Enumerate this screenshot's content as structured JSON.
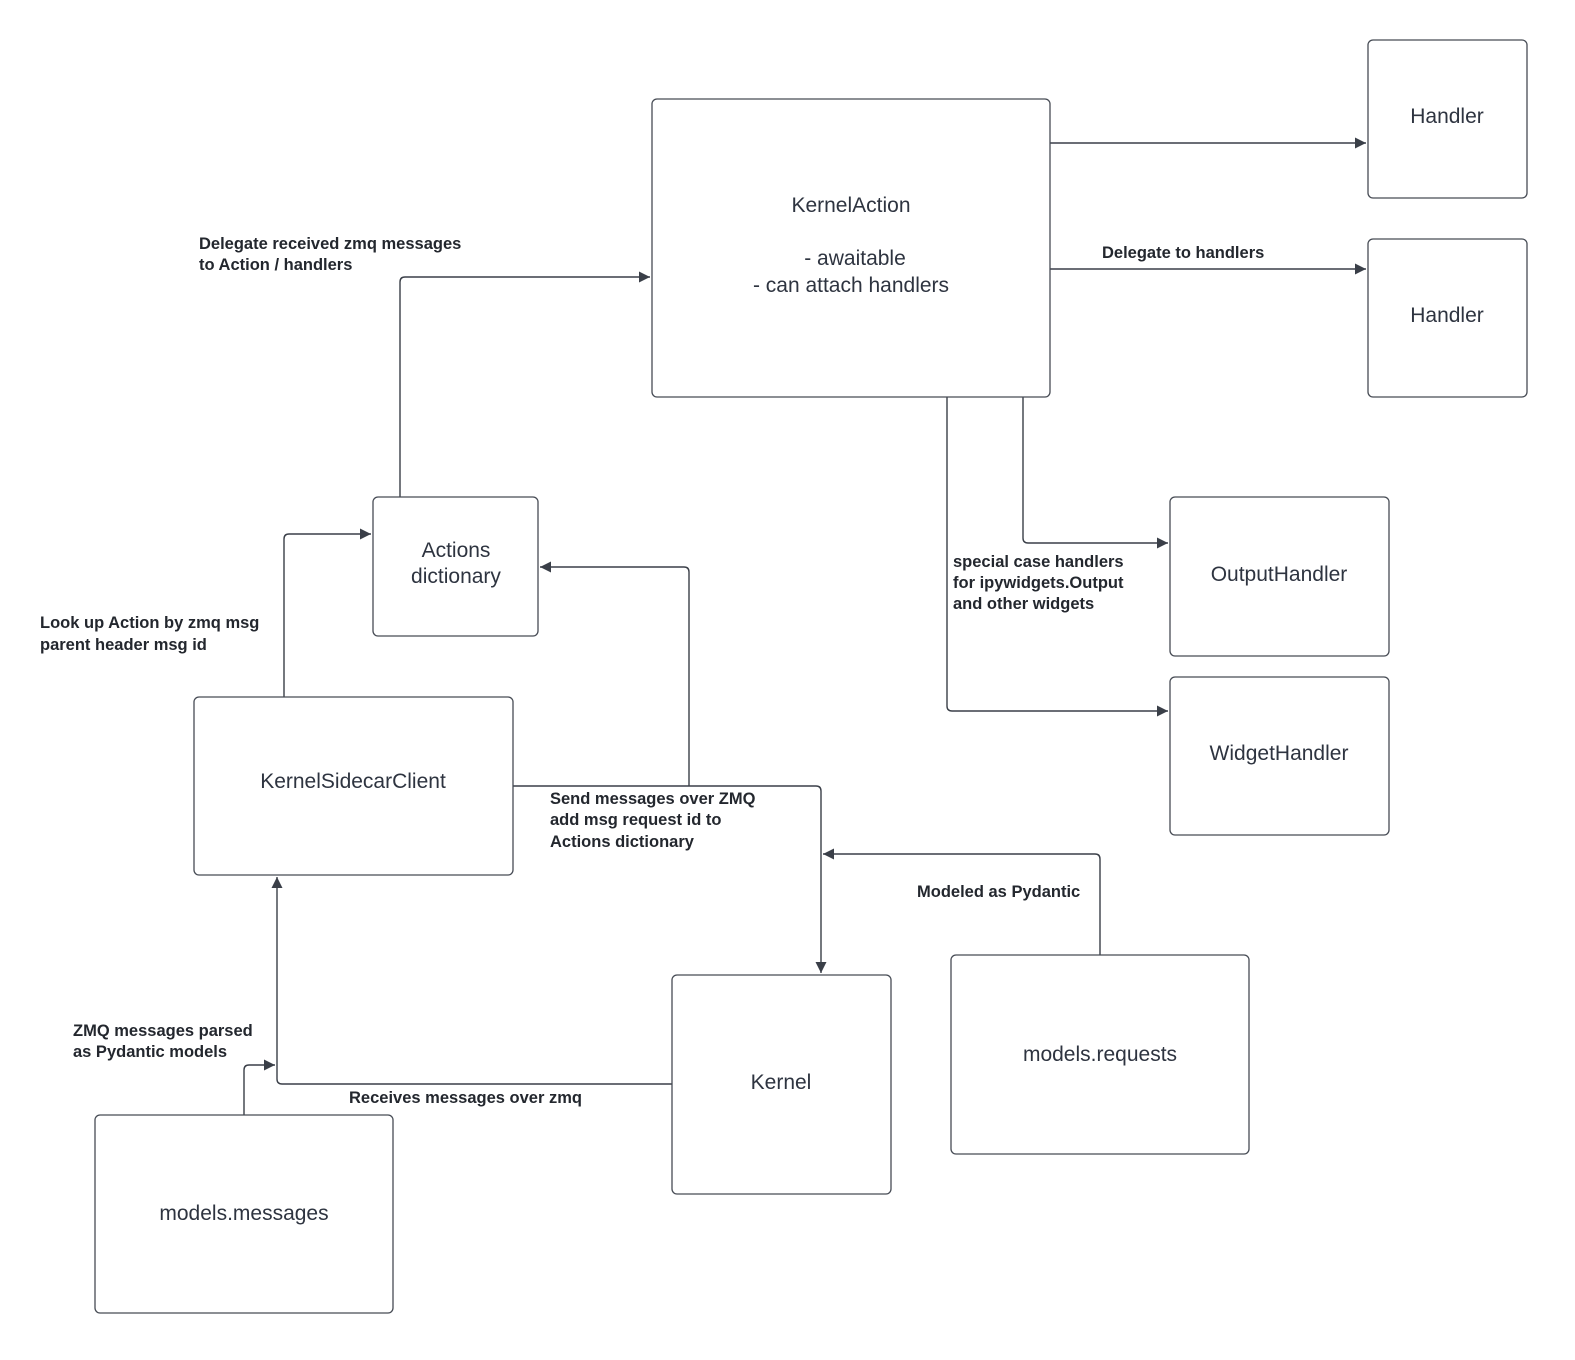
{
  "colors": {
    "stroke": "#474c55",
    "text": "#2e3440",
    "label": "#23272e"
  },
  "nodes": {
    "kernel_action": {
      "title": "KernelAction",
      "lines": [
        "- awaitable",
        "- can attach handlers"
      ]
    },
    "handler_1": "Handler",
    "handler_2": "Handler",
    "actions_dictionary": [
      "Actions",
      "dictionary"
    ],
    "output_handler": "OutputHandler",
    "widget_handler": "WidgetHandler",
    "kernel_sidecar_client": "KernelSidecarClient",
    "kernel": "Kernel",
    "models_requests": "models.requests",
    "models_messages": "models.messages"
  },
  "edge_labels": {
    "delegate_received": [
      "Delegate received zmq messages",
      "to Action / handlers"
    ],
    "delegate_to_handlers": "Delegate to handlers",
    "look_up_action": [
      "Look up Action by zmq msg",
      "parent header msg id"
    ],
    "special_case": [
      "special case handlers",
      "for ipywidgets.Output",
      "and other widgets"
    ],
    "send_messages": [
      "Send messages over ZMQ",
      "add msg request id to",
      "Actions dictionary"
    ],
    "modeled_as_pydantic": "Modeled as Pydantic",
    "zmq_parsed": [
      "ZMQ messages parsed",
      "as Pydantic models"
    ],
    "receives_messages": "Receives messages over zmq"
  }
}
